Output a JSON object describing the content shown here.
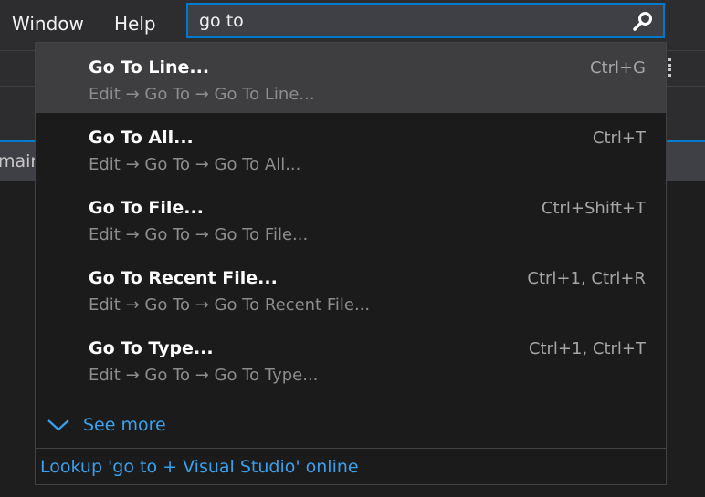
{
  "menubar": {
    "items": [
      {
        "label": "Window"
      },
      {
        "label": "Help"
      }
    ]
  },
  "search": {
    "value": "go to",
    "icon": "search-icon"
  },
  "background": {
    "tab_fragment": "mair"
  },
  "results": [
    {
      "title": "Go To Line...",
      "path": "Edit → Go To → Go To Line...",
      "shortcut": "Ctrl+G",
      "selected": true
    },
    {
      "title": "Go To All...",
      "path": "Edit → Go To → Go To All...",
      "shortcut": "Ctrl+T",
      "selected": false
    },
    {
      "title": "Go To File...",
      "path": "Edit → Go To → Go To File...",
      "shortcut": "Ctrl+Shift+T",
      "selected": false
    },
    {
      "title": "Go To Recent File...",
      "path": "Edit → Go To → Go To Recent File...",
      "shortcut": "Ctrl+1, Ctrl+R",
      "selected": false
    },
    {
      "title": "Go To Type...",
      "path": "Edit → Go To → Go To Type...",
      "shortcut": "Ctrl+1, Ctrl+T",
      "selected": false
    }
  ],
  "see_more": {
    "label": "See more",
    "icon": "chevron-down-icon"
  },
  "lookup": {
    "label": "Lookup 'go to + Visual Studio' online"
  },
  "colors": {
    "accent": "#007acc",
    "link": "#3aa0ec",
    "panel_bg": "#1b1b1c",
    "selected_bg": "#3e3e40"
  }
}
